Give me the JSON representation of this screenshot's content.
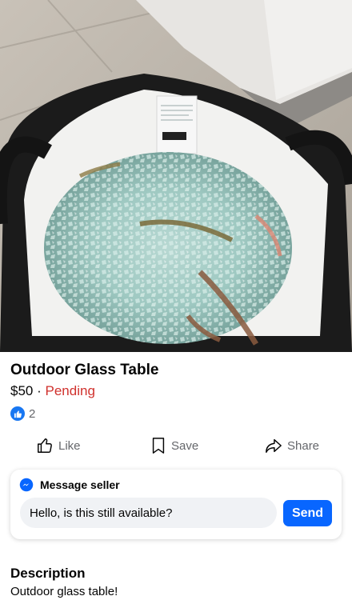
{
  "listing": {
    "title": "Outdoor Glass Table",
    "price": "$50",
    "separator": "·",
    "status": "Pending",
    "status_color": "#d0312d",
    "photo_icon": "listing-photo-bag-of-broken-glass"
  },
  "reactions": {
    "icon": "thumbs-up-icon",
    "count": "2"
  },
  "actions": {
    "like_label": "Like",
    "save_label": "Save",
    "share_label": "Share"
  },
  "message": {
    "heading": "Message seller",
    "icon": "messenger-icon",
    "input_value": "Hello, is this still available?",
    "send_label": "Send",
    "accent_color": "#0866ff"
  },
  "description": {
    "heading": "Description",
    "text": "Outdoor glass table!"
  }
}
